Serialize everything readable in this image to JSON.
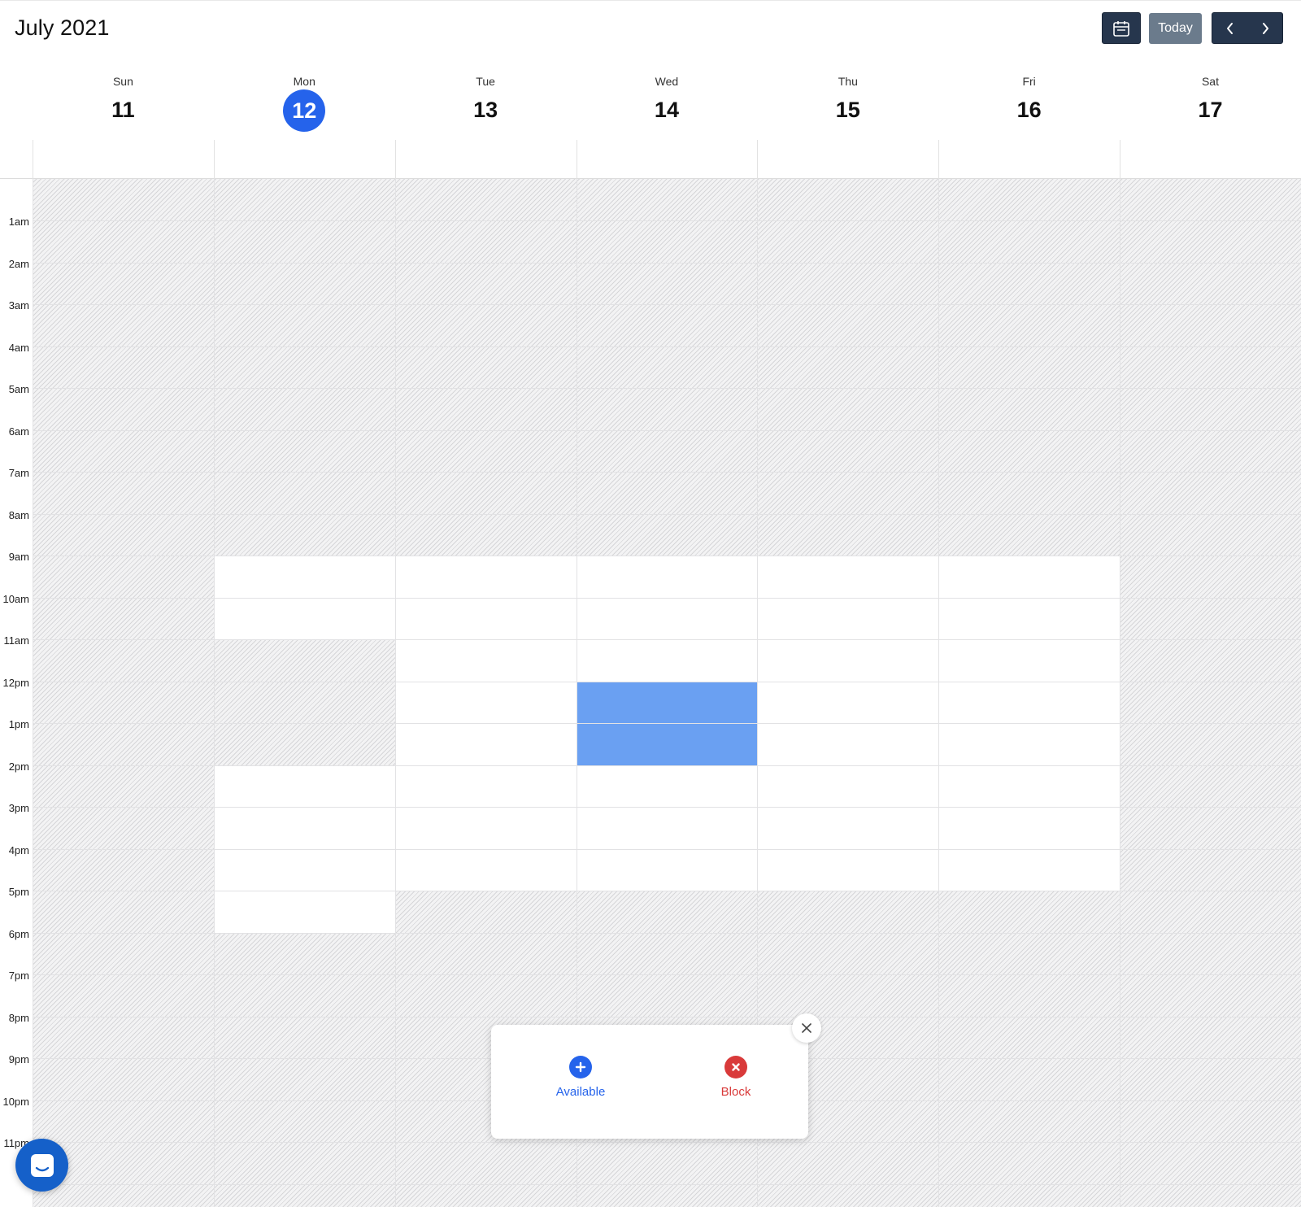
{
  "header": {
    "month_title": "July 2021",
    "today_label": "Today",
    "calendar_icon": "calendar-icon",
    "prev_icon": "chevron-left-icon",
    "next_icon": "chevron-right-icon"
  },
  "days": [
    {
      "dow": "Sun",
      "num": "11"
    },
    {
      "dow": "Mon",
      "num": "12",
      "today": true
    },
    {
      "dow": "Tue",
      "num": "13"
    },
    {
      "dow": "Wed",
      "num": "14"
    },
    {
      "dow": "Thu",
      "num": "15"
    },
    {
      "dow": "Fri",
      "num": "16"
    },
    {
      "dow": "Sat",
      "num": "17"
    }
  ],
  "hours": [
    "1am",
    "2am",
    "3am",
    "4am",
    "5am",
    "6am",
    "7am",
    "8am",
    "9am",
    "10am",
    "11am",
    "12pm",
    "1pm",
    "2pm",
    "3pm",
    "4pm",
    "5pm",
    "6pm",
    "7pm",
    "8pm",
    "9pm",
    "10pm",
    "11pm"
  ],
  "available_ranges": [
    {
      "day": 1,
      "start": 9,
      "end": 11
    },
    {
      "day": 1,
      "start": 14,
      "end": 18
    },
    {
      "day": 2,
      "start": 9,
      "end": 17
    },
    {
      "day": 3,
      "start": 9,
      "end": 17
    },
    {
      "day": 4,
      "start": 9,
      "end": 17
    },
    {
      "day": 5,
      "start": 9,
      "end": 17
    }
  ],
  "selection": {
    "day": 3,
    "start": 12,
    "end": 14
  },
  "popup": {
    "available_label": "Available",
    "block_label": "Block",
    "close_icon": "close-icon",
    "available_icon": "plus-circle-icon",
    "block_icon": "x-circle-icon"
  },
  "chat": {
    "icon": "chat-launcher-icon"
  },
  "colors": {
    "accent": "#2563eb",
    "selection": "#6aa0f2",
    "block": "#d93a3a",
    "nav_dark": "#26364d",
    "today_btn": "#6b7b8c"
  }
}
